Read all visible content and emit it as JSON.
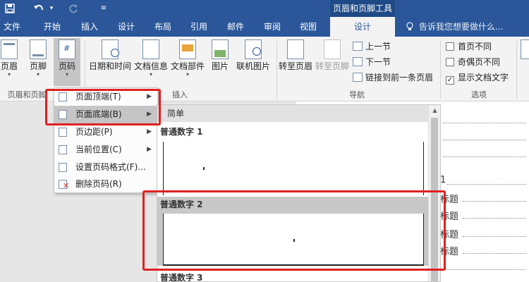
{
  "quick_access": {
    "save_icon": "save-icon",
    "undo_icon": "undo-icon",
    "redo_icon": "redo-icon",
    "customize_icon": "customize-qat-icon"
  },
  "context_tab_title": "页眉和页脚工具",
  "tabs": [
    "文件",
    "开始",
    "插入",
    "设计",
    "布局",
    "引用",
    "邮件",
    "审阅",
    "视图",
    "设计"
  ],
  "tell_me": "告诉我您想要做什么...",
  "ribbon": {
    "header_label": "页眉",
    "footer_label": "页脚",
    "page_number_label": "页码",
    "group_header_footer": "页眉和页脚",
    "date_time_label": "日期和时间",
    "doc_info_label": "文档信息",
    "doc_parts_label": "文档部件",
    "picture_label": "图片",
    "online_picture_label": "联机图片",
    "group_insert": "插入",
    "goto_header_label": "转至页眉",
    "goto_footer_label": "转至页脚",
    "prev_section": "上一节",
    "next_section": "下一节",
    "link_previous": "链接到前一条页眉",
    "group_navigation": "导航",
    "opt_first_page": "首页不同",
    "opt_odd_even": "奇偶页不同",
    "opt_show_text": "显示文档文字",
    "opt_show_text_checked": true,
    "group_options": "选项"
  },
  "page_number_menu": {
    "items": [
      {
        "label": "页面顶端(T)",
        "has_submenu": true
      },
      {
        "label": "页面底端(B)",
        "has_submenu": true,
        "highlighted": true
      },
      {
        "label": "页边距(P)",
        "has_submenu": true
      },
      {
        "label": "当前位置(C)",
        "has_submenu": true
      },
      {
        "label": "设置页码格式(F)...",
        "has_submenu": false
      },
      {
        "label": "删除页码(R)",
        "has_submenu": false
      }
    ]
  },
  "gallery": {
    "category": "简单",
    "items": [
      {
        "label": "普通数字 1"
      },
      {
        "label": "普通数字 2",
        "selected": true
      },
      {
        "label": "普通数字 3"
      }
    ]
  },
  "document": {
    "lines": [
      "1",
      "标题",
      "标题",
      "标题",
      "标题"
    ]
  },
  "colors": {
    "accent": "#2b579a",
    "highlight_box": "#e02020"
  }
}
